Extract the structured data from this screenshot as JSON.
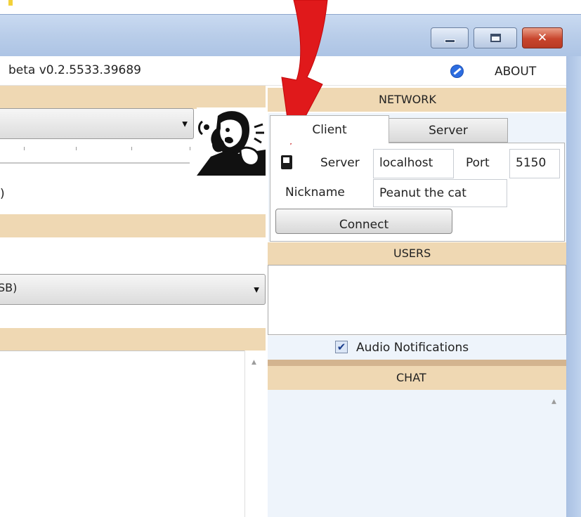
{
  "window": {
    "minimize_icon": "minimize-icon",
    "maximize_icon": "maximize-icon",
    "close_icon": "close-icon",
    "close_glyph": "✕"
  },
  "header": {
    "version": "beta v0.2.5533.39689",
    "about_icon": "about-icon",
    "about_label": "ABOUT"
  },
  "left": {
    "second_combo_text": "SB)",
    "paren_text": ")",
    "combo_arrow": "▼"
  },
  "network": {
    "title": "NETWORK",
    "tabs": [
      {
        "label": "Client",
        "selected": true
      },
      {
        "label": "Server",
        "selected": false
      }
    ],
    "server_label": "Server",
    "server_value": "localhost",
    "port_label": "Port",
    "port_value": "5150",
    "nickname_label": "Nickname",
    "nickname_value": "Peanut the cat",
    "connect_label": "Connect"
  },
  "users": {
    "title": "USERS",
    "audio_notifications_label": "Audio Notifications",
    "audio_notifications_checked": true,
    "check_glyph": "✔"
  },
  "chat": {
    "title": "CHAT",
    "scroll_glyph": "▲"
  },
  "colors": {
    "band": "#efd8b3",
    "panel": "#eef4fb",
    "title_bar": "#b9cde9",
    "close_button": "#c8452d",
    "annotation_arrow": "#e0191b"
  }
}
